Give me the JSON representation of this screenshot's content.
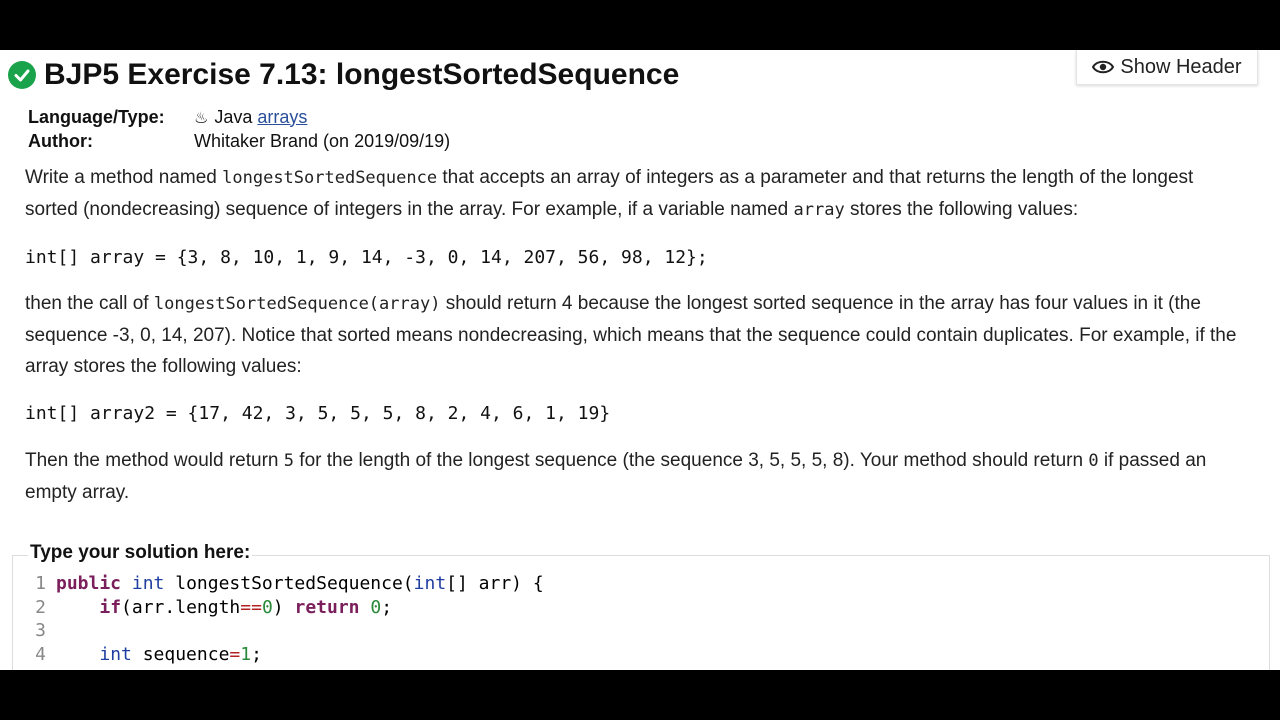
{
  "header": {
    "title": "BJP5 Exercise 7.13: longestSortedSequence",
    "show_header_label": "Show Header"
  },
  "meta": {
    "language_key": "Language/Type:",
    "language_value": "Java",
    "language_link": "arrays",
    "author_key": "Author:",
    "author_value": "Whitaker Brand (on 2019/09/19)"
  },
  "description": {
    "p1_a": "Write a method named ",
    "p1_code": "longestSortedSequence",
    "p1_b": " that accepts an array of integers as a parameter and that returns the length of the longest sorted (nondecreasing) sequence of integers in the array. For example, if a variable named ",
    "p1_code2": "array",
    "p1_c": " stores the following values:",
    "code1": "int[] array = {3, 8, 10, 1, 9, 14, -3, 0, 14, 207, 56, 98, 12};",
    "p2_a": "then the call of ",
    "p2_code": "longestSortedSequence(array)",
    "p2_b": " should return 4 because the longest sorted sequence in the array has four values in it (the sequence -3, 0, 14, 207). Notice that sorted means nondecreasing, which means that the sequence could contain duplicates. For example, if the array stores the following values:",
    "code2": "int[] array2 = {17, 42, 3, 5, 5, 5, 8, 2, 4, 6, 1, 19}",
    "p3_a": "Then the method would return ",
    "p3_code": "5",
    "p3_b": " for the length of the longest sequence (the sequence 3, 5, 5, 5, 8). Your method should return ",
    "p3_code2": "0",
    "p3_c": " if passed an empty array."
  },
  "solution": {
    "label": "Type your solution here:",
    "lines": [
      {
        "n": "1",
        "t": [
          "public",
          " ",
          "int",
          " longestSortedSequence(",
          "int",
          "[] arr) {"
        ]
      },
      {
        "n": "2",
        "t": [
          "    ",
          "if",
          "(arr.length",
          "==",
          "0",
          ") ",
          "return",
          " ",
          "0",
          ";"
        ]
      },
      {
        "n": "3",
        "t": [
          ""
        ]
      },
      {
        "n": "4",
        "t": [
          "    ",
          "int",
          " sequence",
          "=",
          "1",
          ";"
        ]
      }
    ]
  },
  "colors": {
    "check": "#1aa34a",
    "keyword": "#7a1f5c",
    "type": "#1f3ea0",
    "number": "#2a8a3a",
    "operator": "#b32020"
  }
}
